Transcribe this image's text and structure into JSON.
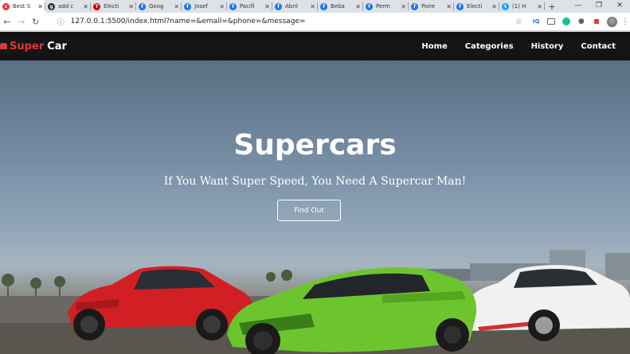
{
  "browser": {
    "tabs": [
      {
        "title": "Best S",
        "favicon": "car-favicon",
        "color": "#e53935",
        "active": true
      },
      {
        "title": "add c",
        "favicon": "github-icon",
        "color": "#24292e"
      },
      {
        "title": "Electi",
        "favicon": "tesla-icon",
        "color": "#cc0000"
      },
      {
        "title": "Goog",
        "favicon": "facebook-icon",
        "color": "#1877f2"
      },
      {
        "title": "Josef",
        "favicon": "facebook-icon",
        "color": "#1877f2"
      },
      {
        "title": "Pacifi",
        "favicon": "facebook-icon",
        "color": "#1877f2"
      },
      {
        "title": "Abril",
        "favicon": "facebook-icon",
        "color": "#1877f2"
      },
      {
        "title": "Beba",
        "favicon": "facebook-icon",
        "color": "#1877f2"
      },
      {
        "title": "Perm",
        "favicon": "facebook-icon",
        "color": "#1877f2"
      },
      {
        "title": "Poire",
        "favicon": "facebook-icon",
        "color": "#1877f2"
      },
      {
        "title": "Electi",
        "favicon": "facebook-icon",
        "color": "#1877f2"
      },
      {
        "title": "(1) H",
        "favicon": "twitter-icon",
        "color": "#1da1f2"
      }
    ],
    "url": "127.0.0.1:5500/index.html?name=&email=&phone=&message="
  },
  "site": {
    "logo_super": "Super",
    "logo_car": "Car",
    "nav": [
      "Home",
      "Categories",
      "History",
      "Contact"
    ],
    "hero_title": "Supercars",
    "hero_subtitle": "If You Want Super Speed, You Need A Supercar Man!",
    "cta_label": "Find Out"
  }
}
